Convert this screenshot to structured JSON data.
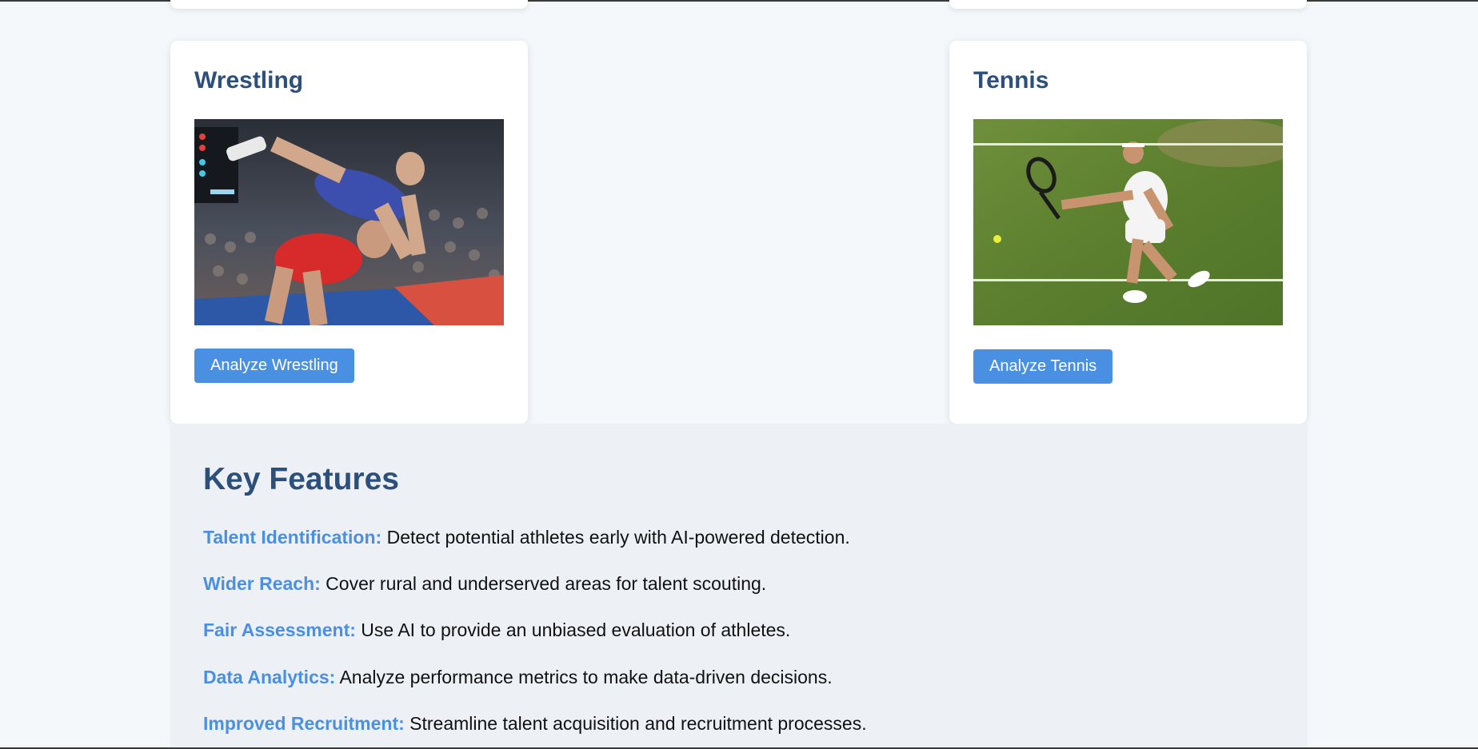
{
  "cards": [
    {
      "title": "Wrestling",
      "image_alt": "Two wrestlers grappling, one in blue lifting one in red, crowd in background",
      "button_label": "Analyze Wrestling"
    },
    {
      "title": "Tennis",
      "image_alt": "Tennis player in white reaching for a ball on a grass court",
      "button_label": "Analyze Tennis"
    }
  ],
  "features": {
    "title": "Key Features",
    "items": [
      {
        "label": "Talent Identification:",
        "text": "Detect potential athletes early with AI-powered detection."
      },
      {
        "label": "Wider Reach:",
        "text": "Cover rural and underserved areas for talent scouting."
      },
      {
        "label": "Fair Assessment:",
        "text": "Use AI to provide an unbiased evaluation of athletes."
      },
      {
        "label": "Data Analytics:",
        "text": "Analyze performance metrics to make data-driven decisions."
      },
      {
        "label": "Improved Recruitment:",
        "text": "Streamline talent acquisition and recruitment processes."
      }
    ]
  },
  "colors": {
    "page_background": "#f4f8fb",
    "features_background": "#edf1f6",
    "heading": "#2c4f7c",
    "accent": "#4a90e2",
    "button_text": "#ffffff"
  }
}
